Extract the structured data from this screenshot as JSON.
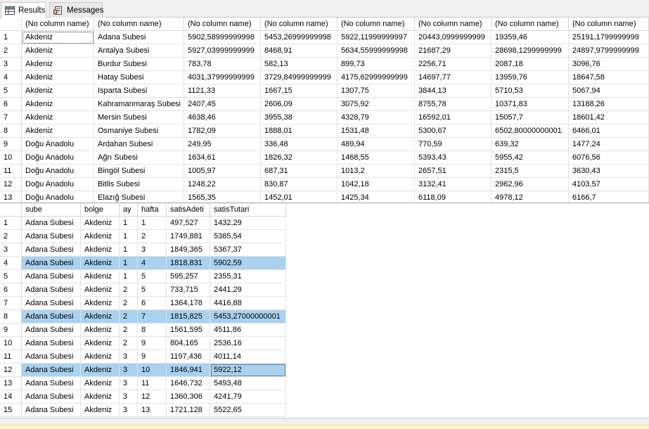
{
  "tabs": {
    "results": "Results",
    "messages": "Messages"
  },
  "grid1": {
    "headers": [
      "(No column name)",
      "(No column name)",
      "(No column name)",
      "(No column name)",
      "(No column name)",
      "(No column name)",
      "(No column name)",
      "(No column name)"
    ],
    "rows": [
      [
        "1",
        "Akdeniz",
        "Adana Subesi",
        "5902,58999999998",
        "5453,26999999998",
        "5922,11999999997",
        "20443,0999999999",
        "19359,46",
        "25191,1799999999"
      ],
      [
        "2",
        "Akdeniz",
        "Antalya Subesi",
        "5927,03999999999",
        "8468,91",
        "5634,55999999998",
        "21687,29",
        "28698,1299999999",
        "24897,9799999999"
      ],
      [
        "3",
        "Akdeniz",
        "Burdur Subesi",
        "783,78",
        "582,13",
        "899,73",
        "2256,71",
        "2087,18",
        "3096,76"
      ],
      [
        "4",
        "Akdeniz",
        "Hatay Subesi",
        "4031,37999999999",
        "3729,84999999999",
        "4175,62999999999",
        "14697,77",
        "13959,76",
        "18647,58"
      ],
      [
        "5",
        "Akdeniz",
        "Isparta Subesi",
        "1121,33",
        "1667,15",
        "1307,75",
        "3844,13",
        "5710,53",
        "5067,94"
      ],
      [
        "6",
        "Akdeniz",
        "Kahramanmaraş Subesi",
        "2407,45",
        "2606,09",
        "3075,92",
        "8755,78",
        "10371,83",
        "13188,26"
      ],
      [
        "7",
        "Akdeniz",
        "Mersin Subesi",
        "4638,46",
        "3955,38",
        "4328,79",
        "16592,01",
        "15057,7",
        "18601,42"
      ],
      [
        "8",
        "Akdeniz",
        "Osmaniye Subesi",
        "1782,09",
        "1888,01",
        "1531,48",
        "5300,67",
        "6502,80000000001",
        "6466,01"
      ],
      [
        "9",
        "Doğu Anadolu",
        "Ardahan Subesi",
        "249,95",
        "336,48",
        "489,94",
        "770,59",
        "639,32",
        "1477,24"
      ],
      [
        "10",
        "Doğu Anadolu",
        "Ağrı Subesi",
        "1634,61",
        "1826,32",
        "1468,55",
        "5393,43",
        "5955,42",
        "6076,56"
      ],
      [
        "11",
        "Doğu Anadolu",
        "Bingöl Subesi",
        "1005,97",
        "687,31",
        "1013,2",
        "2657,51",
        "2315,5",
        "3630,43"
      ],
      [
        "12",
        "Doğu Anadolu",
        "Bitlis Subesi",
        "1248,22",
        "830,87",
        "1042,18",
        "3132,41",
        "2962,96",
        "4103,57"
      ],
      [
        "13",
        "Doğu Anadolu",
        "Elazığ Subesi",
        "1565,35",
        "1452,01",
        "1425,34",
        "6118,09",
        "4978,12",
        "6166,7"
      ]
    ]
  },
  "grid2": {
    "headers": [
      "sube",
      "bolge",
      "ay",
      "hafta",
      "satisAdeti",
      "satisTutari"
    ],
    "rows": [
      [
        "1",
        "Adana Subesi",
        "Akdeniz",
        "1",
        "1",
        "497,527",
        "1432,29"
      ],
      [
        "2",
        "Adana Subesi",
        "Akdeniz",
        "1",
        "2",
        "1749,881",
        "5385,54"
      ],
      [
        "3",
        "Adana Subesi",
        "Akdeniz",
        "1",
        "3",
        "1849,365",
        "5367,37"
      ],
      [
        "4",
        "Adana Subesi",
        "Akdeniz",
        "1",
        "4",
        "1818,831",
        "5902,59"
      ],
      [
        "5",
        "Adana Subesi",
        "Akdeniz",
        "1",
        "5",
        "595,257",
        "2355,31"
      ],
      [
        "6",
        "Adana Subesi",
        "Akdeniz",
        "2",
        "5",
        "733,715",
        "2441,29"
      ],
      [
        "7",
        "Adana Subesi",
        "Akdeniz",
        "2",
        "6",
        "1364,178",
        "4416,88"
      ],
      [
        "8",
        "Adana Subesi",
        "Akdeniz",
        "2",
        "7",
        "1815,825",
        "5453,27000000001"
      ],
      [
        "9",
        "Adana Subesi",
        "Akdeniz",
        "2",
        "8",
        "1561,595",
        "4511,86"
      ],
      [
        "10",
        "Adana Subesi",
        "Akdeniz",
        "2",
        "9",
        "804,165",
        "2536,16"
      ],
      [
        "11",
        "Adana Subesi",
        "Akdeniz",
        "3",
        "9",
        "1197,436",
        "4011,14"
      ],
      [
        "12",
        "Adana Subesi",
        "Akdeniz",
        "3",
        "10",
        "1846,941",
        "5922,12"
      ],
      [
        "13",
        "Adana Subesi",
        "Akdeniz",
        "3",
        "11",
        "1646,732",
        "5493,48"
      ],
      [
        "14",
        "Adana Subesi",
        "Akdeniz",
        "3",
        "12",
        "1360,306",
        "4241,79"
      ],
      [
        "15",
        "Adana Subesi",
        "Akdeniz",
        "3",
        "13",
        "1721,128",
        "5522,65"
      ]
    ],
    "selected_rows": [
      4,
      8,
      12
    ]
  },
  "colors": {
    "selection": "#a9d1f0",
    "gridline": "#e3e3e3",
    "background": "#ffffff"
  }
}
